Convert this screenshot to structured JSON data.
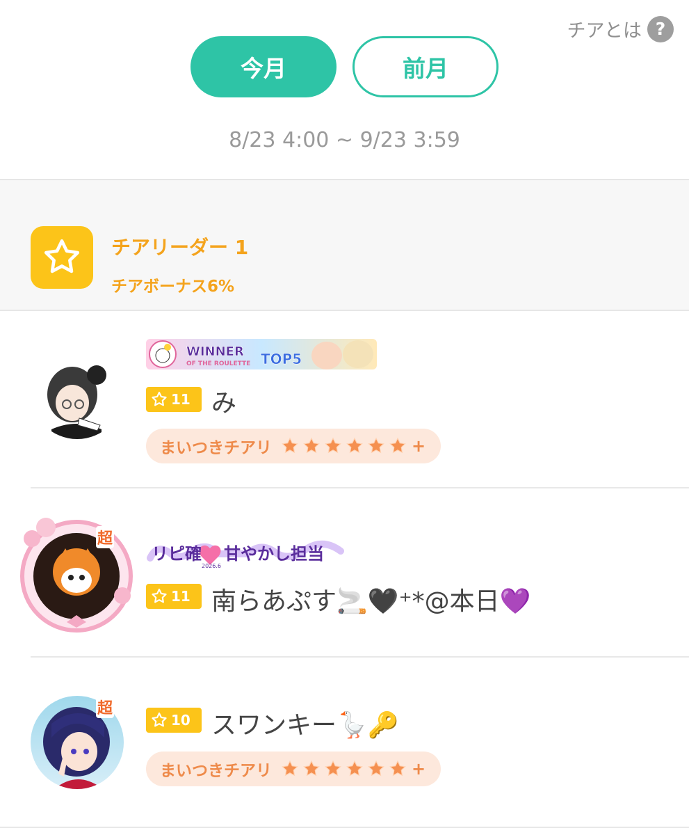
{
  "header": {
    "help_label": "チアとは",
    "help_icon_glyph": "?"
  },
  "tabs": [
    {
      "label": "今月",
      "active": true
    },
    {
      "label": "前月",
      "active": false
    }
  ],
  "period": "8/23 4:00 ~ 9/23 3:59",
  "leader": {
    "title": "チアリーダー 1",
    "bonus": "チアボーナス6%",
    "icon": "star-icon",
    "color": "#fcc419"
  },
  "users": [
    {
      "level": "11",
      "name": "み",
      "banner": "winner-of-the-roulette-top5-banner",
      "cheer_label": "まいつきチアリ",
      "cheer_stars": 6,
      "cheer_plus": "+"
    },
    {
      "level": "11",
      "name": "南らあぷす🚬🖤⁺*@本日💜",
      "banner": "sweet-spoiler-2026-banner",
      "cho_label": "超"
    },
    {
      "level": "10",
      "name": "スワンキー🪿🔑",
      "cho_label": "超",
      "cheer_label": "まいつきチアリ",
      "cheer_stars": 6,
      "cheer_plus": "+"
    }
  ],
  "colors": {
    "accent": "#2ec4a6",
    "gold": "#fcc419",
    "orange": "#f4a31c",
    "cheer_bg": "#fde8dc",
    "cheer_text": "#ee8a4a"
  }
}
